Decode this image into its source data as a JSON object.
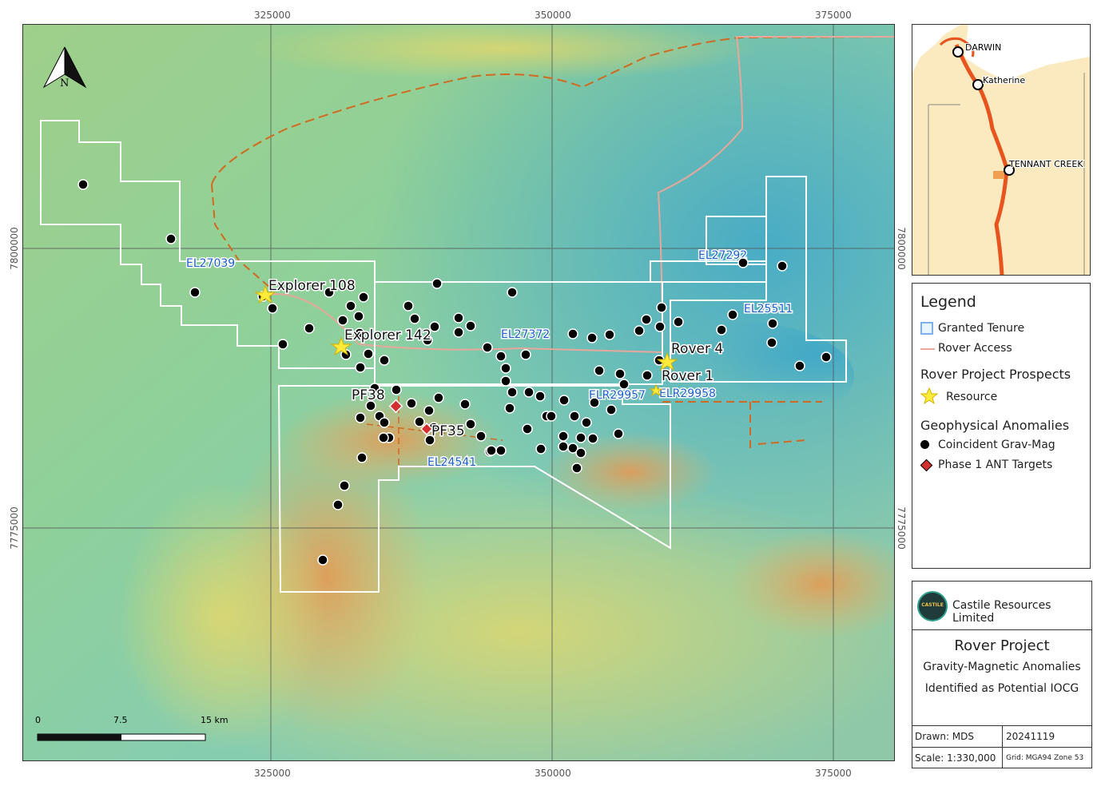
{
  "grid": {
    "eastings": [
      "325000",
      "350000",
      "375000"
    ],
    "northings": [
      "7800000",
      "7775000"
    ]
  },
  "north_arrow": {
    "label": "N"
  },
  "tenements": [
    {
      "id": "EL27039",
      "label": "EL27039"
    },
    {
      "id": "EL27292",
      "label": "EL27292"
    },
    {
      "id": "EL25511",
      "label": "EL25511"
    },
    {
      "id": "EL27372",
      "label": "EL27372"
    },
    {
      "id": "ELR29957",
      "label": "ELR29957"
    },
    {
      "id": "ELR29958",
      "label": "ELR29958"
    },
    {
      "id": "EL24541",
      "label": "EL24541"
    }
  ],
  "prospects": [
    {
      "name": "Explorer 108",
      "type": "resource"
    },
    {
      "name": "Explorer 142",
      "type": "resource"
    },
    {
      "name": "Rover 4",
      "type": "resource"
    },
    {
      "name": "Rover 1",
      "type": "resource"
    }
  ],
  "ant_targets": [
    {
      "name": "PF38"
    },
    {
      "name": "PF35"
    }
  ],
  "scale_bar": {
    "ticks": [
      "0",
      "7.5",
      "15 km"
    ]
  },
  "inset": {
    "places": [
      "DARWIN",
      "Katherine",
      "TENNANT CREEK"
    ]
  },
  "legend": {
    "title": "Legend",
    "granted_tenure": "Granted Tenure",
    "rover_access": "Rover Access",
    "prospects_heading": "Rover Project Prospects",
    "resource": "Resource",
    "anomalies_heading": "Geophysical Anomalies",
    "coincident": "Coincident Grav-Mag",
    "phase1": "Phase 1 ANT Targets"
  },
  "title_block": {
    "company": "Castile Resources Limited",
    "logo_text": "CASTILE",
    "project": "Rover Project",
    "subtitle1": "Gravity-Magnetic Anomalies",
    "subtitle2": "Identified as Potential IOCG",
    "drawn": "Drawn: MDS",
    "date": "20241119",
    "scale": "Scale: 1:330,000",
    "grid": "Grid: MGA94 Zone 53"
  },
  "colors": {
    "tenure": "#ffffff",
    "tenure_label": "#1a5fd0",
    "rover_access": "#e8a79a",
    "dashed_road": "#d2691e",
    "resource_star": "#ffeb3b",
    "anomaly_dot": "#000000",
    "ant_target": "#d32f2f",
    "inset_land": "#fbeac0",
    "inset_road": "#e8541e"
  }
}
